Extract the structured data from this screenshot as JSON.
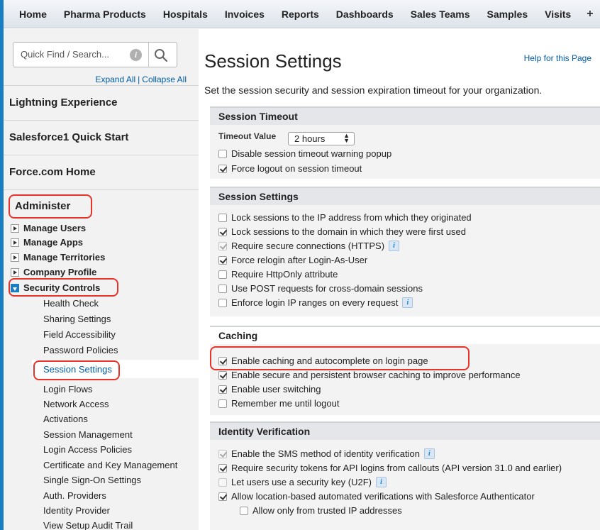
{
  "nav": {
    "tabs": [
      "Home",
      "Pharma Products",
      "Hospitals",
      "Invoices",
      "Reports",
      "Dashboards",
      "Sales Teams",
      "Samples",
      "Visits"
    ],
    "plus": "+"
  },
  "sidebar": {
    "search_placeholder": "Quick Find / Search...",
    "expand_all": "Expand All",
    "separator": "|",
    "collapse_all": "Collapse All",
    "sections": [
      "Lightning Experience",
      "Salesforce1 Quick Start",
      "Force.com Home"
    ],
    "administer": "Administer",
    "tree": [
      "Manage Users",
      "Manage Apps",
      "Manage Territories",
      "Company Profile",
      "Security Controls"
    ],
    "security_items": [
      "Health Check",
      "Sharing Settings",
      "Field Accessibility",
      "Password Policies",
      "Session Settings",
      "Login Flows",
      "Network Access",
      "Activations",
      "Session Management",
      "Login Access Policies",
      "Certificate and Key Management",
      "Single Sign-On Settings",
      "Auth. Providers",
      "Identity Provider",
      "View Setup Audit Trail"
    ]
  },
  "main": {
    "title": "Session Settings",
    "help": "Help for this Page",
    "description": "Set the session security and session expiration timeout for your organization.",
    "timeout": {
      "header": "Session Timeout",
      "label": "Timeout Value",
      "value": "2 hours",
      "options": [
        {
          "label": "Disable session timeout warning popup",
          "checked": false
        },
        {
          "label": "Force logout on session timeout",
          "checked": true
        }
      ]
    },
    "session": {
      "header": "Session Settings",
      "options": [
        {
          "label": "Lock sessions to the IP address from which they originated",
          "checked": false
        },
        {
          "label": "Lock sessions to the domain in which they were first used",
          "checked": true
        },
        {
          "label": "Require secure connections (HTTPS)",
          "checked": true,
          "disabled": true,
          "info": true
        },
        {
          "label": "Force relogin after Login-As-User",
          "checked": true
        },
        {
          "label": "Require HttpOnly attribute",
          "checked": false
        },
        {
          "label": "Use POST requests for cross-domain sessions",
          "checked": false
        },
        {
          "label": "Enforce login IP ranges on every request",
          "checked": false,
          "info": true
        }
      ]
    },
    "caching": {
      "header": "Caching",
      "options": [
        {
          "label": "Enable caching and autocomplete on login page",
          "checked": true
        },
        {
          "label": "Enable secure and persistent browser caching to improve performance",
          "checked": true
        },
        {
          "label": "Enable user switching",
          "checked": true
        },
        {
          "label": "Remember me until logout",
          "checked": false
        }
      ]
    },
    "identity": {
      "header": "Identity Verification",
      "options": [
        {
          "label": "Enable the SMS method of identity verification",
          "checked": true,
          "disabled": true,
          "info": true
        },
        {
          "label": "Require security tokens for API logins from callouts (API version 31.0 and earlier)",
          "checked": true
        },
        {
          "label": "Let users use a security key (U2F)",
          "checked": false,
          "info": true
        },
        {
          "label": "Allow location-based automated verifications with Salesforce Authenticator",
          "checked": true
        },
        {
          "label": "Allow only from trusted IP addresses",
          "checked": false,
          "indent": true
        }
      ]
    }
  }
}
